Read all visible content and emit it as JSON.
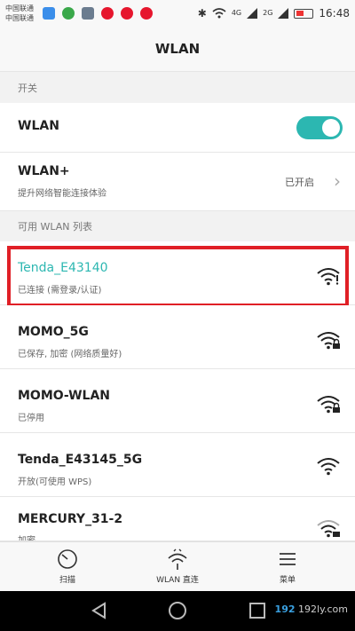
{
  "status_bar": {
    "carrier1": "中国联通",
    "carrier2": "中国联通",
    "net1": "4G",
    "net2": "2G",
    "time": "16:48",
    "app_colors": [
      "#3b8eea",
      "#3aa84a",
      "#6b7c8f",
      "#e6162d",
      "#e6162d",
      "#e6162d"
    ]
  },
  "header": {
    "title": "WLAN"
  },
  "sections": {
    "switch_header": "开关",
    "list_header": "可用 WLAN 列表"
  },
  "wlan_toggle": {
    "label": "WLAN",
    "on": true,
    "accent": "#2cb7b1"
  },
  "wlan_plus": {
    "label": "WLAN+",
    "sub": "提升网络智能连接体验",
    "state": "已开启"
  },
  "networks": [
    {
      "ssid": "Tenda_E43140",
      "status": "已连接 (需登录/认证)",
      "connected": true,
      "color": "#2cb7b1",
      "secured": false
    },
    {
      "ssid": "MOMO_5G",
      "status": "已保存, 加密 (网络质量好)",
      "connected": false,
      "secured": true
    },
    {
      "ssid": "MOMO-WLAN",
      "status": "已停用",
      "connected": false,
      "secured": true
    },
    {
      "ssid": "Tenda_E43145_5G",
      "status": "开放(可使用 WPS)",
      "connected": false,
      "secured": false
    },
    {
      "ssid": "MERCURY_31-2",
      "status": "加密",
      "connected": false,
      "secured": true
    }
  ],
  "bottom_nav": [
    {
      "label": "扫描",
      "icon": "scan-icon"
    },
    {
      "label": "WLAN 直连",
      "icon": "wlan-direct-icon"
    },
    {
      "label": "菜单",
      "icon": "menu-icon"
    }
  ],
  "watermark": {
    "prefix": "192",
    "rest": "192ly.com"
  }
}
